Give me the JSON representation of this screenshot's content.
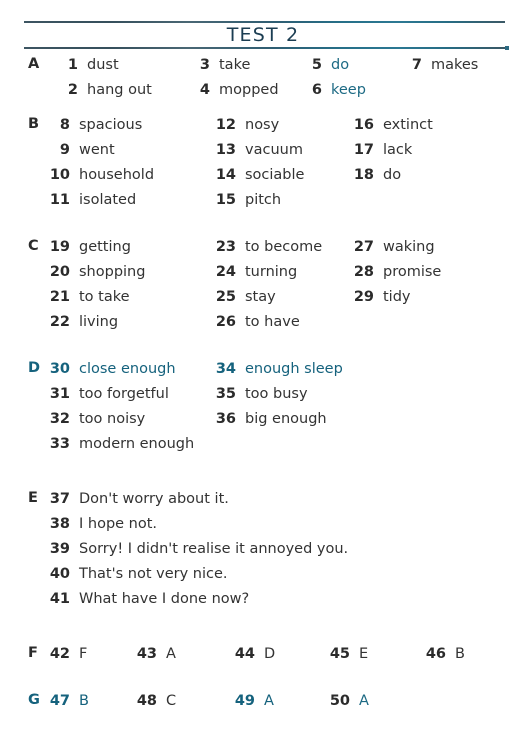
{
  "page": {
    "title": "TEST 2",
    "accent_color": "#1b3d52",
    "rule_color": "#1b5e78",
    "text_color": "#2b2b2b",
    "tint_color": "#15627d",
    "background": "#ffffff"
  },
  "sections": [
    {
      "letter": "A",
      "rows": [
        [
          {
            "num": "1",
            "ans": "dust"
          },
          {
            "num": "3",
            "ans": "take"
          },
          {
            "num": "5",
            "ans": "do"
          },
          {
            "num": "7",
            "ans": "makes"
          }
        ],
        [
          {
            "num": "2",
            "ans": "hang out"
          },
          {
            "num": "4",
            "ans": "mopped"
          },
          {
            "num": "6",
            "ans": "keep"
          }
        ]
      ]
    },
    {
      "letter": "B",
      "rows": [
        [
          {
            "num": "8",
            "ans": "spacious"
          },
          {
            "num": "12",
            "ans": "nosy"
          },
          {
            "num": "16",
            "ans": "extinct"
          }
        ],
        [
          {
            "num": "9",
            "ans": "went"
          },
          {
            "num": "13",
            "ans": "vacuum"
          },
          {
            "num": "17",
            "ans": "lack"
          }
        ],
        [
          {
            "num": "10",
            "ans": "household"
          },
          {
            "num": "14",
            "ans": "sociable"
          },
          {
            "num": "18",
            "ans": "do"
          }
        ],
        [
          {
            "num": "11",
            "ans": "isolated"
          },
          {
            "num": "15",
            "ans": "pitch"
          }
        ]
      ]
    },
    {
      "letter": "C",
      "rows": [
        [
          {
            "num": "19",
            "ans": "getting"
          },
          {
            "num": "23",
            "ans": "to become"
          },
          {
            "num": "27",
            "ans": "waking"
          }
        ],
        [
          {
            "num": "20",
            "ans": "shopping"
          },
          {
            "num": "24",
            "ans": "turning"
          },
          {
            "num": "28",
            "ans": "promise"
          }
        ],
        [
          {
            "num": "21",
            "ans": "to take"
          },
          {
            "num": "25",
            "ans": "stay"
          },
          {
            "num": "29",
            "ans": "tidy"
          }
        ],
        [
          {
            "num": "22",
            "ans": "living"
          },
          {
            "num": "26",
            "ans": "to have"
          }
        ]
      ]
    },
    {
      "letter": "D",
      "rows": [
        [
          {
            "num": "30",
            "ans": "close enough"
          },
          {
            "num": "34",
            "ans": "enough sleep"
          }
        ],
        [
          {
            "num": "31",
            "ans": "too forgetful"
          },
          {
            "num": "35",
            "ans": "too busy"
          }
        ],
        [
          {
            "num": "32",
            "ans": "too noisy"
          },
          {
            "num": "36",
            "ans": "big enough"
          }
        ],
        [
          {
            "num": "33",
            "ans": "modern enough"
          }
        ]
      ]
    },
    {
      "letter": "E",
      "rows": [
        [
          {
            "num": "37",
            "ans": "Don't worry about it."
          }
        ],
        [
          {
            "num": "38",
            "ans": "I hope not."
          }
        ],
        [
          {
            "num": "39",
            "ans": "Sorry! I didn't realise it annoyed you."
          }
        ],
        [
          {
            "num": "40",
            "ans": "That's not very nice."
          }
        ],
        [
          {
            "num": "41",
            "ans": "What have I done now?"
          }
        ]
      ]
    },
    {
      "letter": "F",
      "rows": [
        [
          {
            "num": "42",
            "ans": "F"
          },
          {
            "num": "43",
            "ans": "A"
          },
          {
            "num": "44",
            "ans": "D"
          },
          {
            "num": "45",
            "ans": "E"
          },
          {
            "num": "46",
            "ans": "B"
          }
        ]
      ]
    },
    {
      "letter": "G",
      "rows": [
        [
          {
            "num": "47",
            "ans": "B"
          },
          {
            "num": "48",
            "ans": "C"
          },
          {
            "num": "49",
            "ans": "A"
          },
          {
            "num": "50",
            "ans": "A"
          }
        ]
      ]
    }
  ]
}
